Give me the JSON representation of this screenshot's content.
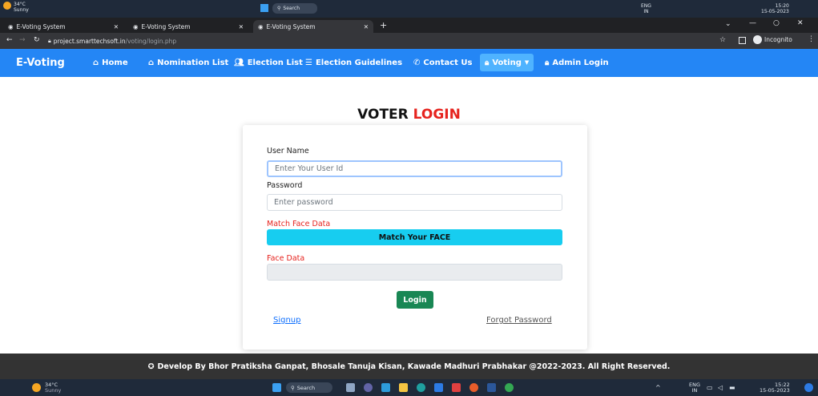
{
  "os_top": {
    "weather_temp": "34°C",
    "weather_desc": "Sunny",
    "search_label": "Search",
    "lang": "ENG",
    "region": "IN",
    "time": "15:20",
    "date": "15-05-2023"
  },
  "browser": {
    "tabs": [
      {
        "title": "E-Voting System",
        "active": false
      },
      {
        "title": "E-Voting System",
        "active": false
      },
      {
        "title": "E-Voting System",
        "active": true
      }
    ],
    "url_host": "project.smarttechsoft.in",
    "url_path": "/voting/login.php",
    "incognito_label": "Incognito"
  },
  "navbar": {
    "brand": "E-Voting",
    "items": [
      {
        "label": "Home",
        "icon": "home-icon"
      },
      {
        "label": "Nomination List",
        "icon": "home-icon"
      },
      {
        "label": "Election List",
        "icon": "users-icon"
      },
      {
        "label": "Election Guidelines",
        "icon": "list-icon"
      },
      {
        "label": "Contact Us",
        "icon": "phone-icon"
      },
      {
        "label": "Voting",
        "icon": "lock-icon"
      },
      {
        "label": "Admin Login",
        "icon": "lock-icon"
      }
    ]
  },
  "page": {
    "title_part1": "VOTER",
    "title_part2": "LOGIN"
  },
  "form": {
    "username_label": "User Name",
    "username_placeholder": "Enter Your User Id",
    "password_label": "Password",
    "password_placeholder": "Enter password",
    "match_face_label": "Match Face Data",
    "match_face_button": "Match Your FACE",
    "face_data_label": "Face Data",
    "login_button": "Login",
    "signup_link": "Signup",
    "forgot_link": "Forgot Password"
  },
  "footer": {
    "text": "Develop By Bhor Pratiksha Ganpat, Bhosale Tanuja Kisan, Kawade Madhuri Prabhakar @2022-2023. All Right Reserved."
  },
  "taskbar": {
    "weather_temp": "34°C",
    "weather_desc": "Sunny",
    "search_label": "Search",
    "lang": "ENG",
    "region": "IN",
    "time": "15:22",
    "date": "15-05-2023"
  },
  "colors": {
    "navbar": "#2486f5",
    "accent_red": "#e6231e",
    "face_button": "#17cdf0",
    "login_button": "#198754",
    "footer": "#333333"
  }
}
